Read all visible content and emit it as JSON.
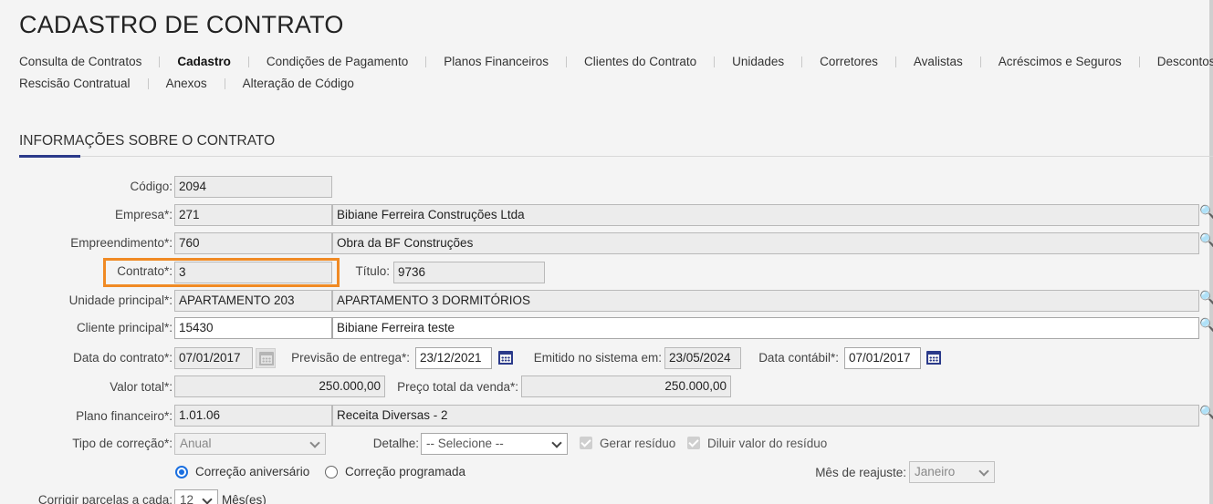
{
  "title": "CADASTRO DE CONTRATO",
  "tabs_row1": [
    "Consulta de Contratos",
    "Cadastro",
    "Condições de Pagamento",
    "Planos Financeiros",
    "Clientes do Contrato",
    "Unidades",
    "Corretores",
    "Avalistas",
    "Acréscimos e Seguros",
    "Descontos"
  ],
  "tabs_row2": [
    "Rescisão Contratual",
    "Anexos",
    "Alteração de Código"
  ],
  "active_tab": "Cadastro",
  "section_title": "INFORMAÇÕES SOBRE O CONTRATO",
  "form": {
    "codigo": {
      "label": "Código:",
      "value": "2094"
    },
    "empresa": {
      "label": "Empresa*:",
      "code": "271",
      "name": "Bibiane Ferreira Construções Ltda"
    },
    "empreendimento": {
      "label": "Empreendimento*:",
      "code": "760",
      "name": "Obra da BF Construções"
    },
    "contrato": {
      "label": "Contrato*:",
      "value": "3"
    },
    "titulo": {
      "label": "Título:",
      "value": "9736"
    },
    "unidade_principal": {
      "label": "Unidade principal*:",
      "code": "APARTAMENTO 203",
      "name": "APARTAMENTO 3 DORMITÓRIOS"
    },
    "cliente_principal": {
      "label": "Cliente principal*:",
      "code": "15430",
      "name": "Bibiane Ferreira teste"
    },
    "data_contrato": {
      "label": "Data do contrato*:",
      "value": "07/01/2017"
    },
    "previsao_entrega": {
      "label": "Previsão de entrega*:",
      "value": "23/12/2021"
    },
    "emitido_sistema": {
      "label": "Emitido no sistema em:",
      "value": "23/05/2024"
    },
    "data_contabil": {
      "label": "Data contábil*:",
      "value": "07/01/2017"
    },
    "valor_total": {
      "label": "Valor total*:",
      "value": "250.000,00"
    },
    "preco_total_venda": {
      "label": "Preço total da venda*:",
      "value": "250.000,00"
    },
    "plano_financeiro": {
      "label": "Plano financeiro*:",
      "code": "1.01.06",
      "name": "Receita Diversas - 2"
    },
    "tipo_correcao": {
      "label": "Tipo de correção*:",
      "value": "Anual"
    },
    "detalhe": {
      "label": "Detalhe:",
      "value": "-- Selecione --"
    },
    "gerar_residuo": {
      "label": "Gerar resíduo",
      "checked": true
    },
    "diluir_residuo": {
      "label": "Diluir valor do resíduo",
      "checked": true
    },
    "radio_aniversario": {
      "label": "Correção aniversário",
      "selected": true
    },
    "radio_programada": {
      "label": "Correção programada",
      "selected": false
    },
    "mes_reajuste": {
      "label": "Mês de reajuste:",
      "value": "Janeiro"
    },
    "corrigir_parcelas": {
      "label": "Corrigir parcelas a cada:",
      "value": "12",
      "unit": "Mês(es)"
    }
  },
  "colors": {
    "accent": "#2b3a8a",
    "highlight": "#f08a24",
    "radio": "#1a6fe0"
  }
}
